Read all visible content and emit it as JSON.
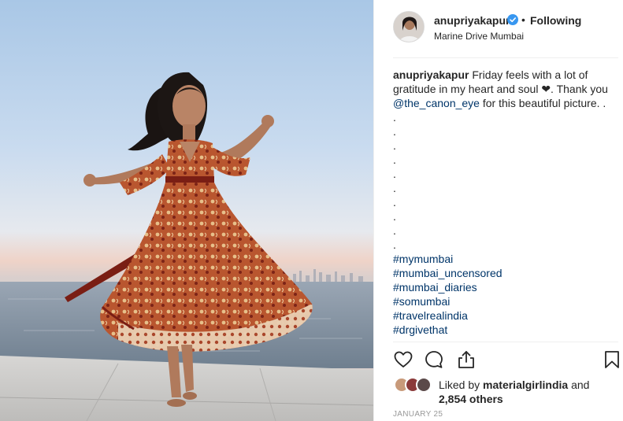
{
  "post": {
    "username": "anupriyakapur",
    "verified": true,
    "follow_separator": "•",
    "follow_label": "Following",
    "location": "Marine Drive Mumbai"
  },
  "caption": {
    "username": "anupriyakapur",
    "text_before": "Friday feels with a lot of gratitude in my heart and soul ❤. Thank you ",
    "mention": "@the_canon_eye",
    "text_after": " for this beautiful picture. .",
    "dot_lines": [
      ".",
      ".",
      ".",
      ".",
      ".",
      ".",
      ".",
      ".",
      ".",
      "."
    ],
    "hashtags": [
      "#mymumbai",
      "#mumbai_uncensored",
      "#mumbai_diaries",
      "#somumbai",
      "#travelrealindia",
      "#drgivethat"
    ]
  },
  "actions": {
    "like_icon": "heart-outline-icon",
    "comment_icon": "comment-bubble-icon",
    "share_icon": "share-upload-icon",
    "save_icon": "bookmark-icon"
  },
  "likes": {
    "prefix": "Liked by ",
    "liker": "materialgirlindia",
    "middle": " and",
    "others": "2,854 others"
  },
  "date": "JANUARY 25",
  "colors": {
    "text": "#262626",
    "link": "#003569",
    "verified": "#3897f0",
    "muted": "#999999",
    "divider": "#efefef"
  }
}
